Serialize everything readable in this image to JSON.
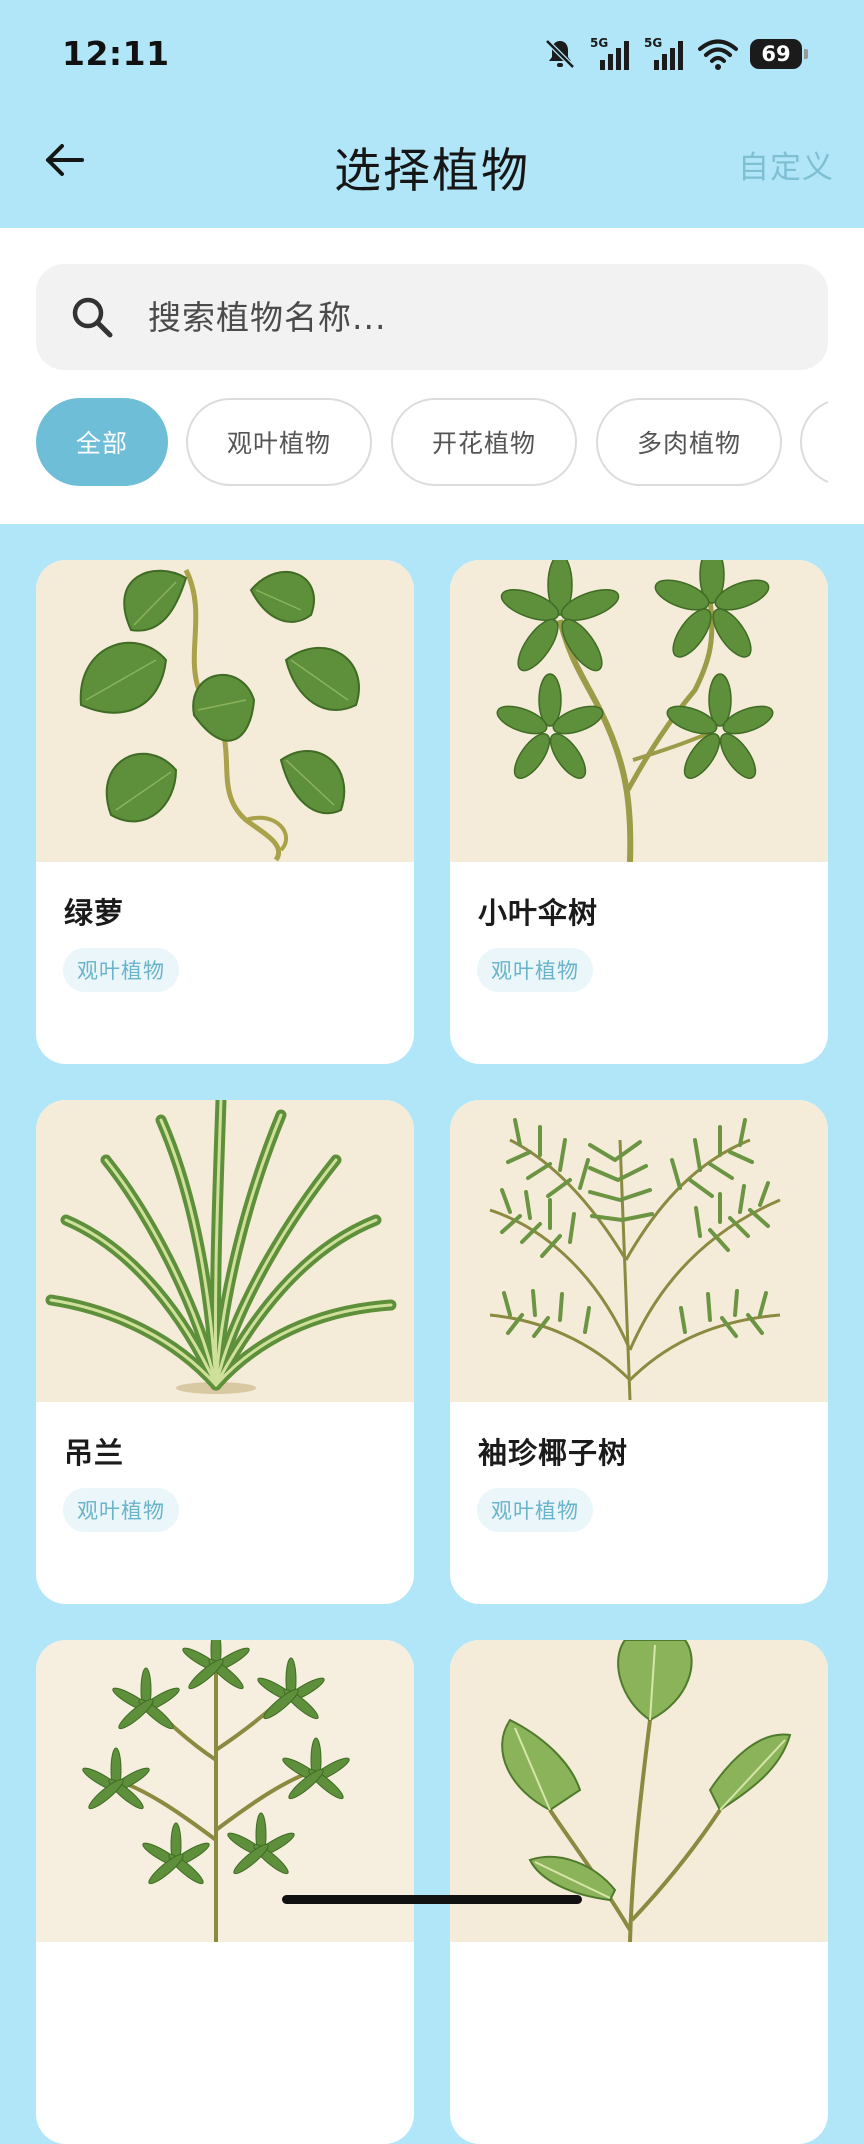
{
  "status_bar": {
    "time": "12:11",
    "battery": "69",
    "network_1": "5G",
    "network_2": "5G",
    "icons": [
      "bell-muted-icon",
      "signal-5g-icon",
      "signal-5g-icon",
      "wifi-icon",
      "battery-icon"
    ]
  },
  "header": {
    "title": "选择植物",
    "back_icon": "arrow-left-icon",
    "custom_label": "自定义"
  },
  "search": {
    "placeholder": "搜索植物名称..."
  },
  "filters": [
    {
      "label": "全部",
      "active": true
    },
    {
      "label": "观叶植物",
      "active": false
    },
    {
      "label": "开花植物",
      "active": false
    },
    {
      "label": "多肉植物",
      "active": false
    },
    {
      "label": "",
      "active": false
    }
  ],
  "plants": [
    {
      "name": "绿萝",
      "tag": "观叶植物",
      "illustration": "pothos-illustration"
    },
    {
      "name": "小叶伞树",
      "tag": "观叶植物",
      "illustration": "umbrella-tree-illustration"
    },
    {
      "name": "吊兰",
      "tag": "观叶植物",
      "illustration": "spider-plant-illustration"
    },
    {
      "name": "袖珍椰子树",
      "tag": "观叶植物",
      "illustration": "parlor-palm-illustration"
    },
    {
      "name": "",
      "tag": "",
      "illustration": "shrub-illustration"
    },
    {
      "name": "",
      "tag": "",
      "illustration": "arrowhead-plant-illustration"
    }
  ],
  "colors": {
    "header_bg": "#b1e6f8",
    "accent": "#6dbed6",
    "tag_text": "#6ab4cb",
    "card_image_bg": "#f4ecd9",
    "leaf": "#5a8a3a"
  }
}
